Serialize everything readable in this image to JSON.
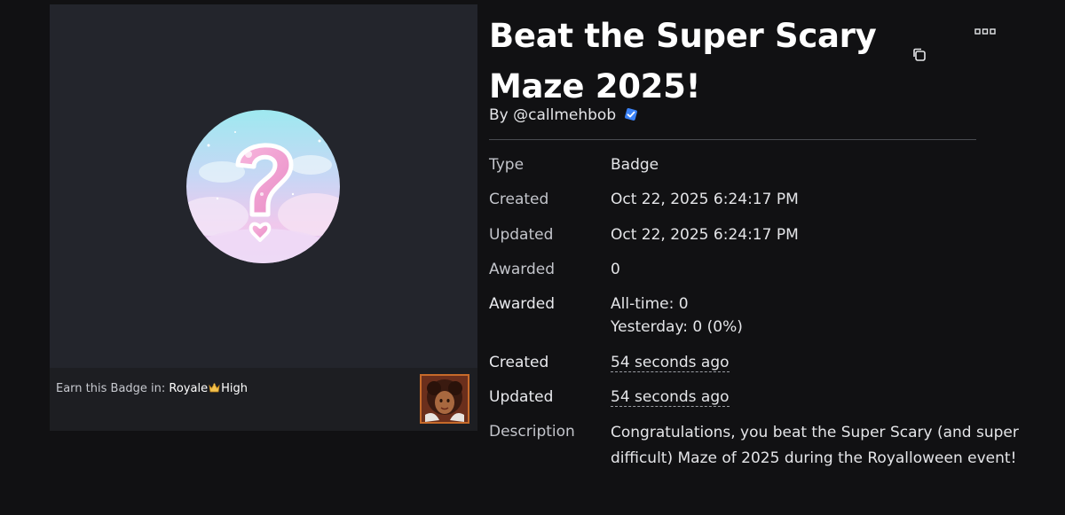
{
  "badge": {
    "title": "Beat the Super Scary Maze 2025!",
    "creator_prefix": "By ",
    "creator": "@callmehbob",
    "earn_prefix": "Earn this Badge in: ",
    "game_name_part1": "Royale",
    "game_name_part2": "High"
  },
  "details": {
    "type_label": "Type",
    "type_value": "Badge",
    "created_label": "Created",
    "created_value": "Oct 22, 2025 6:24:17 PM",
    "updated_label": "Updated",
    "updated_value": "Oct 22, 2025 6:24:17 PM",
    "awarded_label": "Awarded",
    "awarded_value": "0",
    "awarded2_label": "Awarded",
    "awarded_alltime": "All-time: 0",
    "awarded_yesterday": "Yesterday: 0 (0%)",
    "created2_label": "Created",
    "created2_value": "54 seconds ago",
    "updated2_label": "Updated",
    "updated2_value": "54 seconds ago",
    "description_label": "Description",
    "description_line1": "Congratulations, you beat the Super Scary (and super",
    "description_line2": "difficult) Maze of 2025 during the Royalloween event!"
  },
  "icons": {
    "copy": "copy-icon",
    "more": "more-options-icon",
    "verified": "verified-badge-icon",
    "crown": "crown-emoji-icon"
  },
  "colors": {
    "background": "#111113",
    "card": "#232429",
    "verified": "#3b82f6"
  }
}
